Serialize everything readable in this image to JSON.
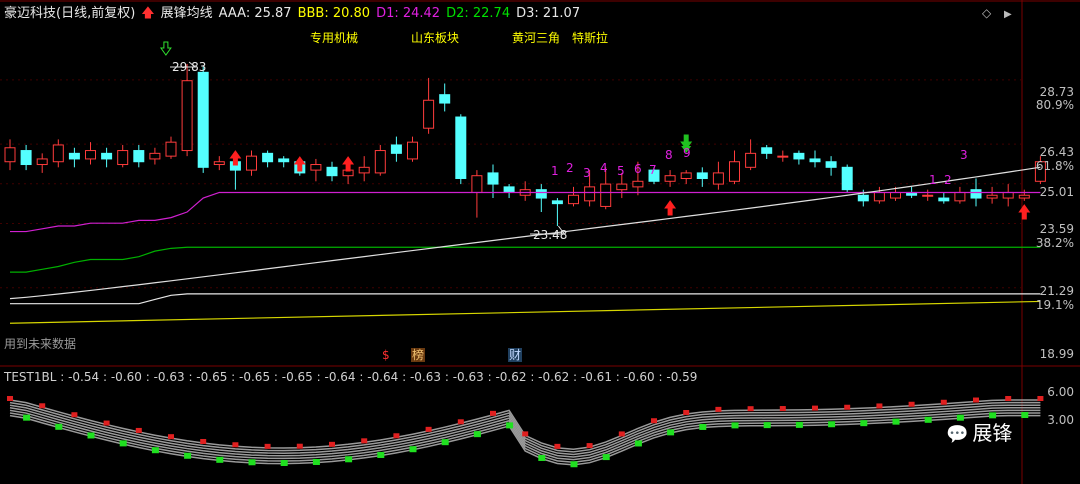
{
  "header": {
    "stock": "豪迈科技(日线,前复权)",
    "indicator": "展锋均线",
    "aaa": "AAA: 25.87",
    "bbb": "BBB: 20.80",
    "d1": "D1: 24.42",
    "d2": "D2: 22.74",
    "d3": "D3: 21.07"
  },
  "tags": [
    "专用机械",
    "山东板块",
    "黄河三角",
    "特斯拉"
  ],
  "price_axis": [
    "28.73",
    "80.9%",
    "26.43",
    "61.8%",
    "25.01",
    "23.59",
    "38.2%",
    "21.29",
    "19.1%",
    "18.99"
  ],
  "annotations": {
    "high": "29.83",
    "low": "23.48",
    "future_data": "用到未来数据",
    "markers": [
      "$",
      "榜",
      "财"
    ],
    "counts_a": [
      "1",
      "2",
      "3",
      "4",
      "5",
      "6",
      "7",
      "8",
      "9"
    ],
    "counts_b": [
      "1",
      "2",
      "3"
    ]
  },
  "subchart": {
    "title": "TEST1BL",
    "values": [
      "-0.54",
      "-0.60",
      "-0.63",
      "-0.65",
      "-0.65",
      "-0.65",
      "-0.64",
      "-0.64",
      "-0.63",
      "-0.63",
      "-0.62",
      "-0.62",
      "-0.61",
      "-0.60",
      "-0.59"
    ],
    "axis": [
      "6.00",
      "3.00"
    ]
  },
  "watermark": "展锋",
  "controls": {
    "diamond": "◇",
    "arrow": "▶"
  },
  "colors": {
    "up": "#ff3c3c",
    "down": "#54ffff",
    "ma_white": "#e0e0e0",
    "ma_magenta": "#d020d0",
    "ma_green": "#00b000",
    "ma_yellow": "#d6d600",
    "ma_light": "#e8e8e8"
  },
  "chart_data": {
    "type": "candlestick",
    "candles": [
      [
        25.8,
        26.3,
        25.5,
        26.6
      ],
      [
        26.2,
        25.7,
        25.5,
        26.4
      ],
      [
        25.7,
        25.9,
        25.4,
        26.1
      ],
      [
        25.8,
        26.4,
        25.6,
        26.6
      ],
      [
        26.1,
        25.9,
        25.6,
        26.3
      ],
      [
        25.9,
        26.2,
        25.7,
        26.5
      ],
      [
        26.1,
        25.9,
        25.6,
        26.3
      ],
      [
        25.7,
        26.2,
        25.6,
        26.4
      ],
      [
        26.2,
        25.8,
        25.6,
        26.4
      ],
      [
        25.9,
        26.1,
        25.7,
        26.3
      ],
      [
        26.0,
        26.5,
        25.9,
        26.7
      ],
      [
        26.2,
        28.7,
        26.0,
        29.3
      ],
      [
        29.0,
        25.6,
        25.4,
        29.2
      ],
      [
        25.7,
        25.8,
        25.5,
        26.0
      ],
      [
        25.8,
        25.5,
        24.8,
        26.0
      ],
      [
        25.5,
        26.0,
        25.3,
        26.2
      ],
      [
        26.1,
        25.8,
        25.6,
        26.2
      ],
      [
        25.9,
        25.8,
        25.6,
        26.0
      ],
      [
        25.8,
        25.4,
        25.3,
        25.9
      ],
      [
        25.5,
        25.7,
        25.1,
        25.9
      ],
      [
        25.6,
        25.3,
        25.1,
        25.8
      ],
      [
        25.3,
        25.5,
        25.0,
        25.7
      ],
      [
        25.4,
        25.6,
        25.1,
        26.0
      ],
      [
        25.4,
        26.2,
        25.3,
        26.4
      ],
      [
        26.4,
        26.1,
        25.8,
        26.7
      ],
      [
        25.9,
        26.5,
        25.8,
        26.7
      ],
      [
        27.0,
        28.0,
        26.8,
        28.8
      ],
      [
        28.2,
        27.9,
        27.6,
        28.6
      ],
      [
        27.4,
        25.2,
        25.0,
        27.5
      ],
      [
        24.7,
        25.3,
        23.8,
        25.5
      ],
      [
        25.4,
        25.0,
        24.5,
        25.7
      ],
      [
        24.9,
        24.7,
        24.5,
        25.0
      ],
      [
        24.6,
        24.8,
        24.4,
        25.1
      ],
      [
        24.8,
        24.5,
        24.0,
        25.0
      ],
      [
        24.4,
        24.3,
        23.5,
        24.5
      ],
      [
        24.3,
        24.6,
        24.2,
        24.9
      ],
      [
        24.4,
        24.9,
        24.2,
        25.5
      ],
      [
        24.2,
        25.0,
        24.1,
        25.6
      ],
      [
        24.8,
        25.0,
        24.5,
        25.4
      ],
      [
        24.9,
        25.1,
        24.6,
        25.8
      ],
      [
        25.5,
        25.1,
        25.0,
        25.6
      ],
      [
        25.1,
        25.3,
        24.9,
        25.5
      ],
      [
        25.2,
        25.4,
        25.0,
        25.5
      ],
      [
        25.4,
        25.2,
        24.9,
        25.6
      ],
      [
        25.0,
        25.4,
        24.8,
        25.8
      ],
      [
        25.1,
        25.8,
        25.0,
        26.2
      ],
      [
        25.6,
        26.1,
        25.5,
        26.6
      ],
      [
        26.3,
        26.1,
        25.9,
        26.4
      ],
      [
        26.0,
        26.0,
        25.8,
        26.2
      ],
      [
        26.1,
        25.9,
        25.7,
        26.2
      ],
      [
        25.9,
        25.8,
        25.6,
        26.2
      ],
      [
        25.8,
        25.6,
        25.3,
        26.0
      ],
      [
        25.6,
        24.8,
        24.7,
        25.7
      ],
      [
        24.6,
        24.4,
        24.2,
        24.8
      ],
      [
        24.4,
        24.7,
        24.3,
        24.9
      ],
      [
        24.5,
        24.7,
        24.4,
        24.9
      ],
      [
        24.7,
        24.6,
        24.5,
        24.9
      ],
      [
        24.6,
        24.6,
        24.4,
        24.8
      ],
      [
        24.5,
        24.4,
        24.3,
        24.7
      ],
      [
        24.4,
        24.7,
        24.3,
        24.9
      ],
      [
        24.8,
        24.5,
        24.2,
        25.2
      ],
      [
        24.5,
        24.6,
        24.3,
        24.9
      ],
      [
        24.5,
        24.7,
        24.2,
        25.0
      ],
      [
        24.5,
        24.6,
        24.4,
        24.8
      ],
      [
        25.1,
        25.8,
        25.0,
        26.0
      ]
    ],
    "ylim": [
      18.99,
      30.3
    ],
    "ma_lines": [
      {
        "name": "D1",
        "values": [
          23.3,
          23.3,
          23.4,
          23.5,
          23.5,
          23.6,
          23.6,
          23.6,
          23.7,
          23.7,
          23.8,
          24.0,
          24.5,
          24.7,
          24.7,
          24.7,
          24.7,
          24.7,
          24.7,
          24.7,
          24.7,
          24.7,
          24.7,
          24.7,
          24.7,
          24.7,
          24.7,
          24.7,
          24.7,
          24.7,
          24.7,
          24.7,
          24.7,
          24.7,
          24.7,
          24.7,
          24.7,
          24.7,
          24.7,
          24.7,
          24.7,
          24.7,
          24.7,
          24.7,
          24.7,
          24.7,
          24.7,
          24.7,
          24.7,
          24.7,
          24.7,
          24.7,
          24.7,
          24.7,
          24.7,
          24.7,
          24.7,
          24.7,
          24.7,
          24.7,
          24.7,
          24.7,
          24.7,
          24.7,
          24.7
        ]
      }
    ]
  }
}
